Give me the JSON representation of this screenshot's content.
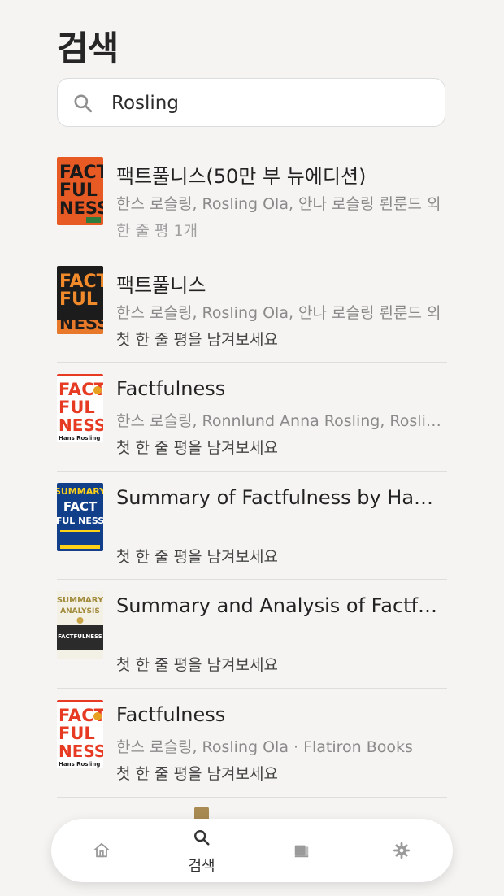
{
  "page": {
    "title": "검색"
  },
  "search": {
    "value": "Rosling"
  },
  "results": [
    {
      "title": "팩트풀니스(50만 부 뉴에디션)",
      "author": "한스 로슬링, Rosling Ola, 안나 로슬링 뢴룬드 외",
      "review": "한 줄 평 1개",
      "cover": {
        "top_text": "FACT",
        "mid_text": "FUL",
        "bottom_text": "NESS",
        "bg": "#e85a24",
        "fg": "#1a1a1a"
      }
    },
    {
      "title": "팩트풀니스",
      "author": "한스 로슬링, Rosling Ola, 안나 로슬링 뢴룬드 외",
      "review": "첫 한 줄 평을 남겨보세요",
      "cover": {
        "top_text": "FACT",
        "mid_text": "FUL",
        "bottom_text": "NESS",
        "bg": "#1c1c1c",
        "fg": "#f08a2a"
      }
    },
    {
      "title": "Factfulness",
      "author": "한스 로슬링, Ronnlund Anna Rosling, Rosling Ola",
      "review": "첫 한 줄 평을 남겨보세요",
      "cover": {
        "top_text": "FACT",
        "mid_text": "FUL",
        "bottom_text": "NESS",
        "bg": "#ffffff",
        "fg": "#e63a22",
        "byline": "Hans Rosling"
      }
    },
    {
      "title": "Summary of Factfulness by Hans Rosling",
      "author": "",
      "review": "첫 한 줄 평을 남겨보세요",
      "cover": {
        "top_text": "SUMMARY",
        "mid_text": "FACT",
        "bottom_text": "FUL NESS",
        "bg": "#123f8a",
        "fg": "#ffd21a"
      }
    },
    {
      "title": "Summary and Analysis of Factfulness",
      "author": "",
      "review": "첫 한 줄 평을 남겨보세요",
      "cover": {
        "top_text": "SUMMARY",
        "mid_text": "ANALYSIS",
        "bottom_text": "FACTFULNESS",
        "bg": "#f3f0e6",
        "fg": "#a08a3a"
      }
    },
    {
      "title": "Factfulness",
      "author": "한스 로슬링, Rosling Ola · Flatiron Books",
      "review": "첫 한 줄 평을 남겨보세요",
      "cover": {
        "top_text": "FACT",
        "mid_text": "FUL",
        "bottom_text": "NESS",
        "bg": "#ffffff",
        "fg": "#e63a22",
        "byline": "Hans Rosling"
      }
    }
  ],
  "nav": {
    "home": {
      "icon": "home-icon"
    },
    "search": {
      "icon": "search-icon",
      "label": "검색"
    },
    "library": {
      "icon": "book-icon"
    },
    "settings": {
      "icon": "gear-icon"
    }
  },
  "colors": {
    "background": "#f5f4f2",
    "text": "#262626",
    "muted": "#8a8a8a"
  }
}
